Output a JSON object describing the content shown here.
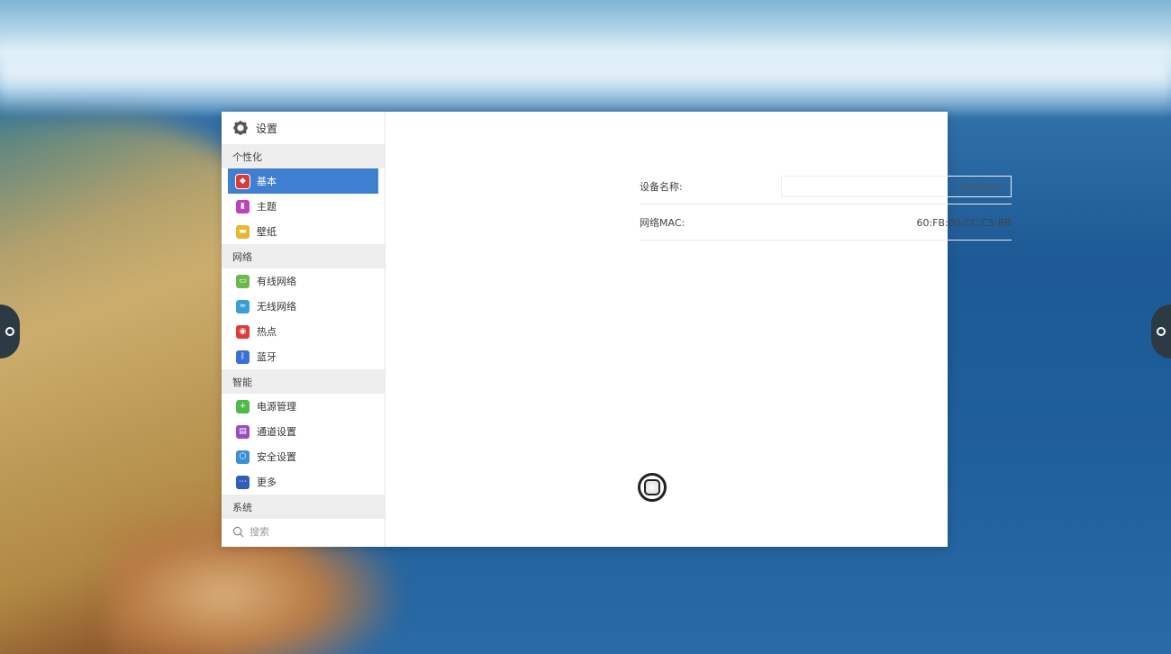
{
  "sidebar": {
    "title": "设置",
    "sections": [
      {
        "label": "个性化",
        "items": [
          {
            "label": "基本",
            "icon": "basic-icon",
            "color": "#d83a3a",
            "active": true
          },
          {
            "label": "主题",
            "icon": "theme-icon",
            "color": "#c23fbf",
            "active": false
          },
          {
            "label": "壁纸",
            "icon": "wallpaper-icon",
            "color": "#e8b830",
            "active": false
          }
        ]
      },
      {
        "label": "网络",
        "items": [
          {
            "label": "有线网络",
            "icon": "wired-network-icon",
            "color": "#6cb84a",
            "active": false
          },
          {
            "label": "无线网络",
            "icon": "wifi-icon",
            "color": "#3a9fd6",
            "active": false
          },
          {
            "label": "热点",
            "icon": "hotspot-icon",
            "color": "#e03a3a",
            "active": false
          },
          {
            "label": "蓝牙",
            "icon": "bluetooth-icon",
            "color": "#3a6fd6",
            "active": false
          }
        ]
      },
      {
        "label": "智能",
        "items": [
          {
            "label": "电源管理",
            "icon": "power-icon",
            "color": "#4cbb4a",
            "active": false
          },
          {
            "label": "通道设置",
            "icon": "channel-icon",
            "color": "#9a4cc0",
            "active": false
          },
          {
            "label": "安全设置",
            "icon": "security-icon",
            "color": "#3a8fd6",
            "active": false
          },
          {
            "label": "更多",
            "icon": "more-icon",
            "color": "#2f5fb8",
            "active": false
          }
        ]
      },
      {
        "label": "系统",
        "items": []
      }
    ],
    "search_placeholder": "搜索"
  },
  "content": {
    "device_name_label": "设备名称:",
    "device_name_value": "DzShare",
    "mac_label": "网络MAC:",
    "mac_value": "60:FB:00:CC:C5:BB"
  },
  "colors": {
    "accent": "#3f7fd1"
  }
}
